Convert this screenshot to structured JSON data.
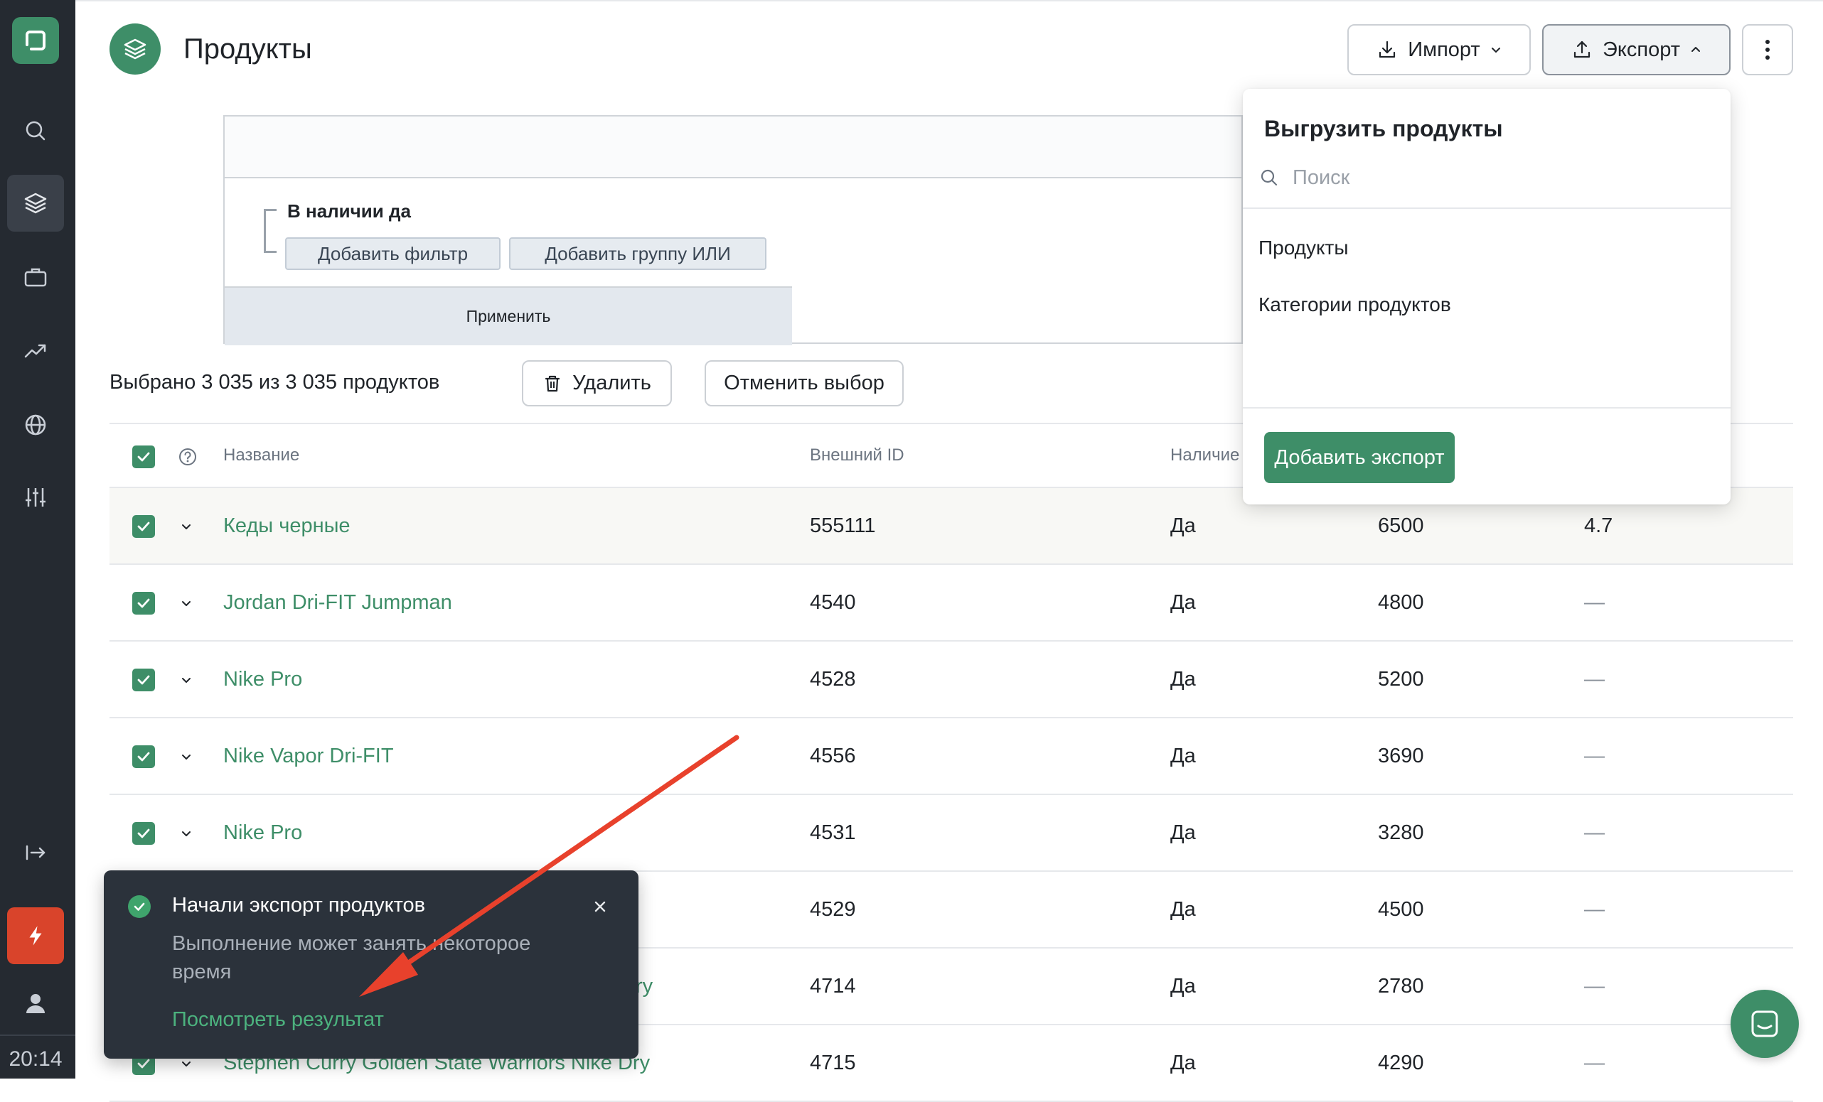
{
  "app": {
    "title": "Продукты"
  },
  "sidebar": {
    "time": "20:14"
  },
  "header": {
    "import_label": "Импорт",
    "export_label": "Экспорт"
  },
  "filter": {
    "condition": "В наличии да",
    "add_filter": "Добавить фильтр",
    "add_or_group": "Добавить группу ИЛИ",
    "apply": "Применить"
  },
  "selection": {
    "text": "Выбрано 3 035 из 3 035 продуктов",
    "delete": "Удалить",
    "cancel": "Отменить выбор"
  },
  "table": {
    "columns": {
      "name": "Название",
      "external_id": "Внешний ID",
      "availability": "Наличие"
    },
    "rows": [
      {
        "name": "Кеды черные",
        "external_id": "555111",
        "availability": "Да",
        "price": "6500",
        "rating": "4.7"
      },
      {
        "name": "Jordan Dri-FIT Jumpman",
        "external_id": "4540",
        "availability": "Да",
        "price": "4800",
        "rating": "—"
      },
      {
        "name": "Nike Pro",
        "external_id": "4528",
        "availability": "Да",
        "price": "5200",
        "rating": "—"
      },
      {
        "name": "Nike Vapor Dri-FIT",
        "external_id": "4556",
        "availability": "Да",
        "price": "3690",
        "rating": "—"
      },
      {
        "name": "Nike Pro",
        "external_id": "4531",
        "availability": "Да",
        "price": "3280",
        "rating": "—"
      },
      {
        "name": "",
        "external_id": "4529",
        "availability": "Да",
        "price": "4500",
        "rating": "—"
      },
      {
        "name": "ry",
        "external_id": "4714",
        "availability": "Да",
        "price": "2780",
        "rating": "—"
      },
      {
        "name": "Stephen Curry Golden State Warriors Nike Dry",
        "external_id": "4715",
        "availability": "Да",
        "price": "4290",
        "rating": "—"
      }
    ]
  },
  "export_dropdown": {
    "title": "Выгрузить продукты",
    "search_placeholder": "Поиск",
    "items": [
      "Продукты",
      "Категории продуктов"
    ],
    "add_export": "Добавить экспорт"
  },
  "toast": {
    "title": "Начали экспорт продуктов",
    "body": "Выполнение может занять некоторое время",
    "link": "Посмотреть результат"
  },
  "colors": {
    "accent": "#3e8e68",
    "sidebar_bg": "#252a31",
    "toast_bg": "#2b323b",
    "danger": "#d9442b",
    "arrow": "#e8412c"
  }
}
